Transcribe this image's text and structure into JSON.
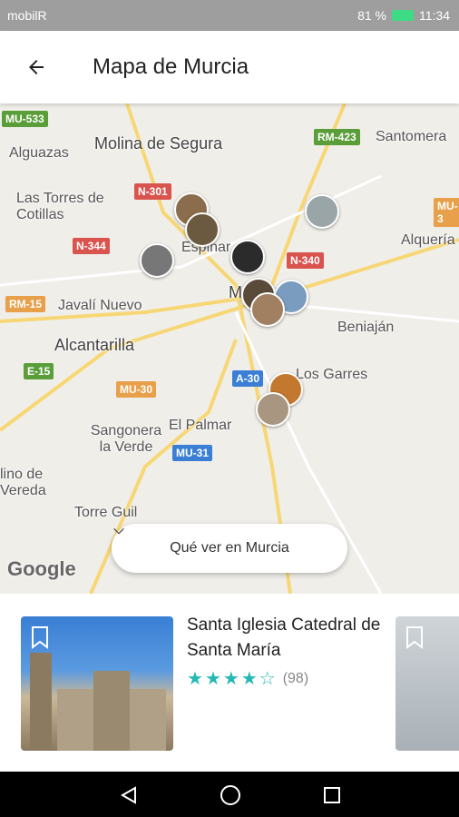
{
  "status_bar": {
    "carrier": "mobilR",
    "battery": "81 %",
    "time": "11:34"
  },
  "app_bar": {
    "title": "Mapa de Murcia"
  },
  "map": {
    "places": [
      "Molina de Segura",
      "Alguazas",
      "Las Torres de Cotillas",
      "Espinar",
      "Javalí Nuevo",
      "Alcantarilla",
      "Santomera",
      "Alquería",
      "Beniaján",
      "Los Garres",
      "El Palmar",
      "Sangonera la Verde",
      "lino de Vereda",
      "Torre Guil",
      "M"
    ],
    "roads": [
      "MU-533",
      "RM-423",
      "N-301",
      "N-344",
      "N-340",
      "RM-15",
      "E-15",
      "MU-30",
      "A-30",
      "MU-31",
      "MU-3"
    ],
    "attribution": "Google"
  },
  "filter_pill": {
    "label": "Qué ver en Murcia"
  },
  "card": {
    "name": "Santa Iglesia Catedral de Santa María",
    "rating": 4.5,
    "reviews": "(98)"
  },
  "colors": {
    "accent": "#26b8b4",
    "status_bar": "#9e9e9e"
  }
}
